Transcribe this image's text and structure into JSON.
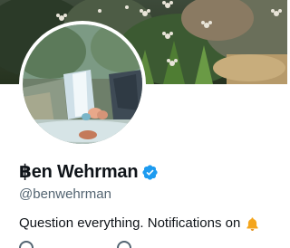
{
  "profile": {
    "display_name": "฿en Wehrman",
    "handle": "@benwehrman",
    "bio": "Question everything. Notifications on"
  },
  "icons": {
    "verified": "verified-badge-icon",
    "bell": "bell-icon"
  },
  "colors": {
    "verified_blue": "#1d9bf0",
    "text_primary": "#0f1419",
    "text_secondary": "#536471",
    "bell_orange": "#f4a51c"
  }
}
